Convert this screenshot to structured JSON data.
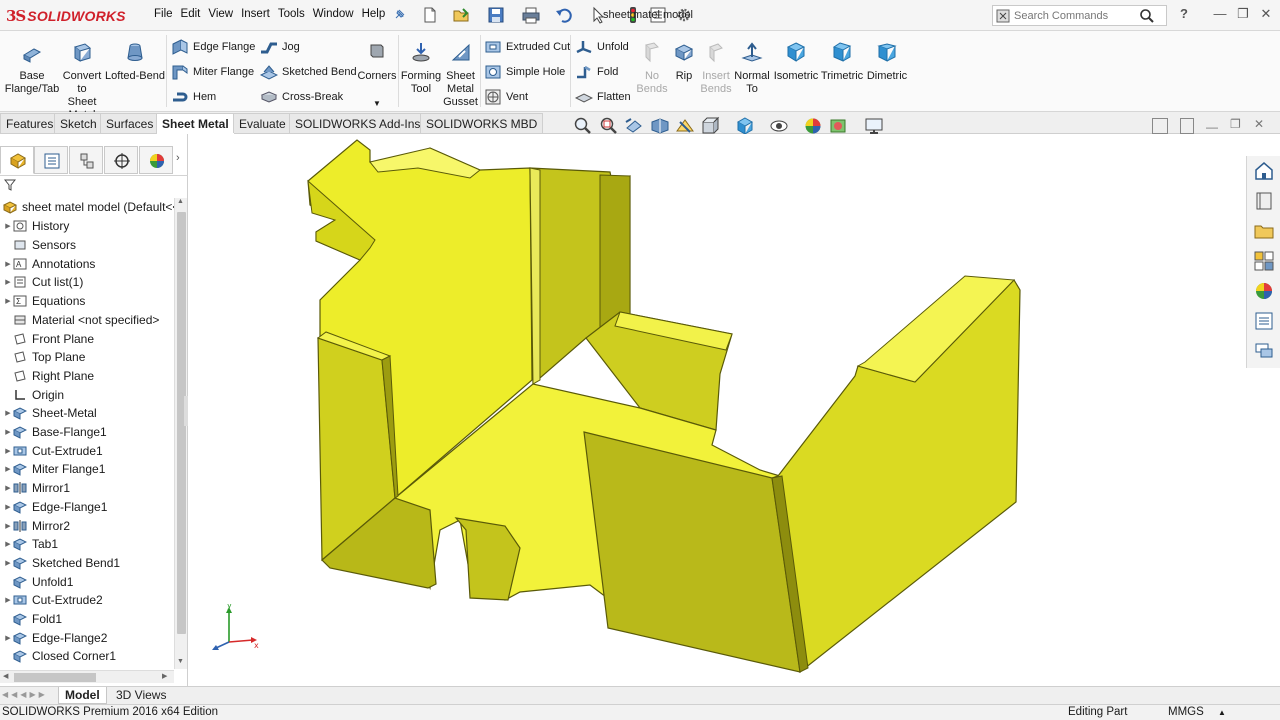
{
  "app": {
    "logo_text": "SOLIDWORKS",
    "document_title": "sheet matel model",
    "menu": [
      "File",
      "Edit",
      "View",
      "Insert",
      "Tools",
      "Window",
      "Help"
    ],
    "search_placeholder": "Search Commands",
    "help_label": "?"
  },
  "ribbon": {
    "base_flange": "Base Flange/Tab",
    "convert": "Convert to Sheet Metal",
    "lofted_bend": "Lofted-Bend",
    "edge_flange": "Edge Flange",
    "miter_flange": "Miter Flange",
    "hem": "Hem",
    "jog": "Jog",
    "sketched_bend": "Sketched Bend",
    "cross_break": "Cross-Break",
    "corners": "Corners",
    "forming_tool": "Forming Tool",
    "gusset": "Sheet Metal Gusset",
    "extruded_cut": "Extruded Cut",
    "simple_hole": "Simple Hole",
    "vent": "Vent",
    "unfold": "Unfold",
    "fold": "Fold",
    "flatten": "Flatten",
    "no_bends": "No Bends",
    "rip": "Rip",
    "insert_bends": "Insert Bends",
    "normal_to": "Normal To",
    "isometric": "Isometric",
    "trimetric": "Trimetric",
    "dimetric": "Dimetric"
  },
  "tabs": [
    "Features",
    "Sketch",
    "Surfaces",
    "Sheet Metal",
    "Evaluate",
    "SOLIDWORKS Add-Ins",
    "SOLIDWORKS MBD"
  ],
  "tree": {
    "root": "sheet matel model  (Default<<",
    "items": [
      {
        "label": "History",
        "expand": true
      },
      {
        "label": "Sensors",
        "expand": false
      },
      {
        "label": "Annotations",
        "expand": true
      },
      {
        "label": "Cut list(1)",
        "expand": true
      },
      {
        "label": "Equations",
        "expand": true
      },
      {
        "label": "Material <not specified>",
        "expand": false
      },
      {
        "label": "Front Plane",
        "expand": false
      },
      {
        "label": "Top Plane",
        "expand": false
      },
      {
        "label": "Right Plane",
        "expand": false
      },
      {
        "label": "Origin",
        "expand": false
      },
      {
        "label": "Sheet-Metal",
        "expand": true
      },
      {
        "label": "Base-Flange1",
        "expand": true
      },
      {
        "label": "Cut-Extrude1",
        "expand": true
      },
      {
        "label": "Miter Flange1",
        "expand": true
      },
      {
        "label": "Mirror1",
        "expand": true
      },
      {
        "label": "Edge-Flange1",
        "expand": true
      },
      {
        "label": "Mirror2",
        "expand": true
      },
      {
        "label": "Tab1",
        "expand": true
      },
      {
        "label": "Sketched Bend1",
        "expand": true
      },
      {
        "label": "Unfold1",
        "expand": false
      },
      {
        "label": "Cut-Extrude2",
        "expand": true
      },
      {
        "label": "Fold1",
        "expand": false
      },
      {
        "label": "Edge-Flange2",
        "expand": true
      },
      {
        "label": "Closed Corner1",
        "expand": false
      }
    ]
  },
  "bottom_tabs": [
    "Model",
    "3D Views"
  ],
  "status": {
    "edition": "SOLIDWORKS Premium 2016 x64 Edition",
    "mode": "Editing Part",
    "units": "MMGS"
  },
  "triad": {
    "x": "x",
    "y": "y"
  },
  "colors": {
    "part": "#f2f23a",
    "part_dark": "#8d8d0e",
    "accent": "#1e6fc8",
    "logo": "#d0202a"
  }
}
